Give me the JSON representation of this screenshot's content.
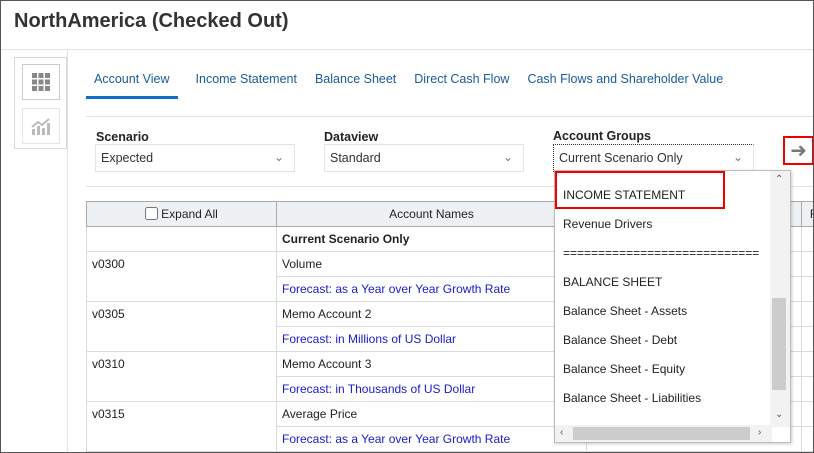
{
  "title": "NorthAmerica (Checked Out)",
  "side": {
    "grid_icon": "grid-icon",
    "chart_icon": "chart-icon"
  },
  "tabs": [
    "Account View",
    "Income Statement",
    "Balance Sheet",
    "Direct Cash Flow",
    "Cash Flows and Shareholder Value"
  ],
  "filters": {
    "scenario": {
      "label": "Scenario",
      "value": "Expected"
    },
    "dataview": {
      "label": "Dataview",
      "value": "Standard"
    },
    "account_groups": {
      "label": "Account Groups",
      "value": "Current Scenario Only"
    }
  },
  "table": {
    "expand_all": "Expand All",
    "account_names": "Account Names",
    "col_f": "F",
    "group_row": "Current Scenario Only",
    "rows": [
      {
        "id": "v0300",
        "name": "Volume",
        "forecast": "Forecast: as a Year over Year Growth Rate"
      },
      {
        "id": "v0305",
        "name": "Memo Account 2",
        "forecast": "Forecast: in Millions of US Dollar"
      },
      {
        "id": "v0310",
        "name": "Memo Account 3",
        "forecast": "Forecast: in Thousands of US Dollar"
      },
      {
        "id": "v0315",
        "name": "Average Price",
        "forecast": "Forecast: as a Year over Year Growth Rate"
      }
    ]
  },
  "dropdown": [
    "INCOME STATEMENT",
    "Revenue Drivers",
    "============================",
    "BALANCE SHEET",
    "Balance Sheet - Assets",
    "Balance Sheet - Debt",
    "Balance Sheet - Equity",
    "Balance Sheet - Liabilities"
  ],
  "colors": {
    "accent": "#0f6fc6",
    "highlight": "#e00000",
    "link": "#1a1ad0"
  }
}
